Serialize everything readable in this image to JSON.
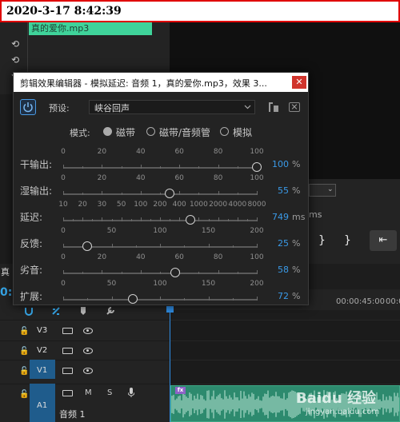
{
  "timestamp": "2020-3-17 8:42:39",
  "project": {
    "clip_name": "真的爱你.mp3"
  },
  "program": {
    "dropdown_fragment": "",
    "ms_fragment": "ms",
    "ruler_tick": "00:00:45:00",
    "ruler_tick_partial": "00:0"
  },
  "timeline": {
    "panel_label": "真",
    "timecode_fragment": "0:0",
    "tracks": [
      {
        "name": "V3"
      },
      {
        "name": "V2"
      },
      {
        "name": "V1"
      },
      {
        "name": "A1",
        "clip_label": "音频 1",
        "m": "M",
        "s": "S"
      }
    ]
  },
  "dialog": {
    "title": "剪辑效果编辑器 - 模拟延迟: 音频 1，真的爱你.mp3，效果 3...",
    "close": "✕",
    "preset_label": "预设:",
    "preset_value": "峡谷回声",
    "mode_label": "模式:",
    "modes": [
      "磁带",
      "磁带/音频管",
      "模拟"
    ],
    "selected_mode": "磁带",
    "params": [
      {
        "name": "干输出:",
        "ticks": [
          "0",
          "20",
          "40",
          "60",
          "80",
          "100"
        ],
        "value": "100",
        "unit": "%",
        "level": 1.0
      },
      {
        "name": "湿输出:",
        "ticks": [
          "0",
          "20",
          "40",
          "60",
          "80",
          "100"
        ],
        "value": "55",
        "unit": "%",
        "level": 0.55
      },
      {
        "name": "延迟:",
        "ticks": [
          "10",
          "20",
          "30",
          "50",
          "100",
          "200",
          "400",
          "1000",
          "2000",
          "4000",
          "8000"
        ],
        "value": "749",
        "unit": "ms",
        "level": 0.655
      },
      {
        "name": "反馈:",
        "ticks": [
          "0",
          "50",
          "100",
          "150",
          "200"
        ],
        "value": "25",
        "unit": "%",
        "level": 0.125
      },
      {
        "name": "劣音:",
        "ticks": [
          "0",
          "20",
          "40",
          "60",
          "80",
          "100"
        ],
        "value": "58",
        "unit": "%",
        "level": 0.58
      },
      {
        "name": "扩展:",
        "ticks": [
          "0",
          "50",
          "100",
          "150",
          "200"
        ],
        "value": "72",
        "unit": "%",
        "level": 0.36
      }
    ]
  },
  "watermark": {
    "text": "Baidu 经验",
    "sub": "jingyan.baidu.com"
  },
  "colors": {
    "accent": "#3a9ae8",
    "clip_green": "#3fd39a",
    "audio_clip": "#2d8a6e",
    "track_blue": "#1f5c8c",
    "close_red": "#d0342c"
  }
}
